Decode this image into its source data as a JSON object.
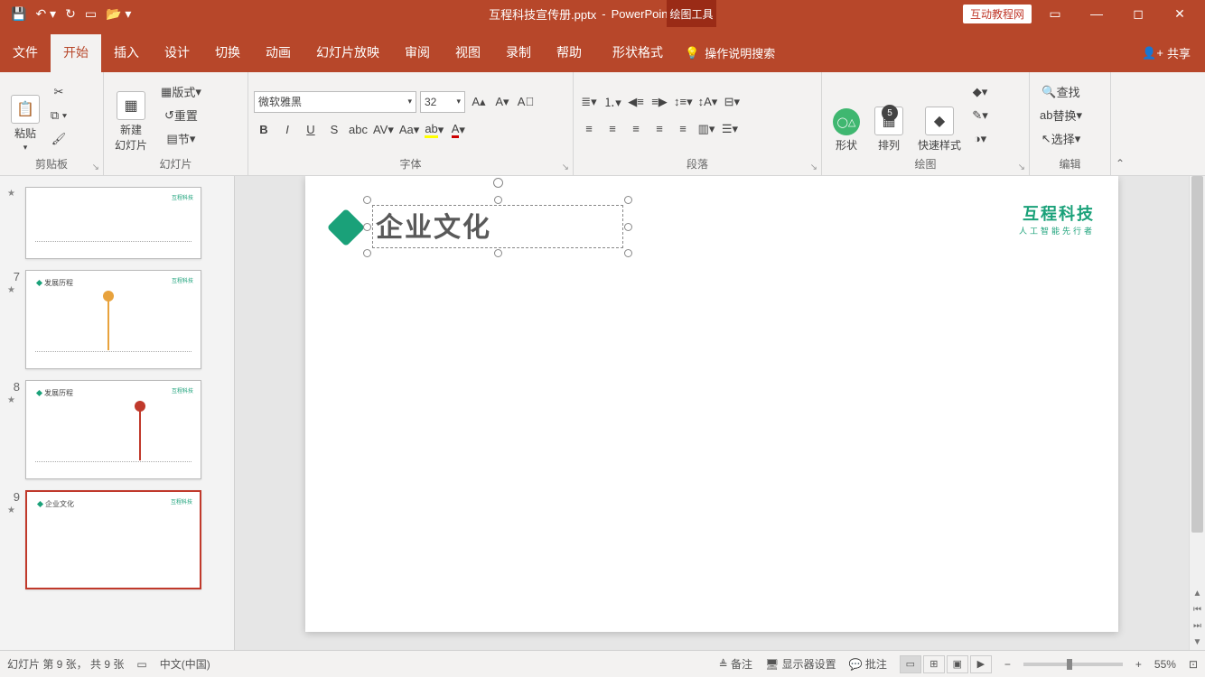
{
  "title": {
    "file": "互程科技宣传册.pptx",
    "app": "PowerPoint Preview",
    "context": "绘图工具",
    "badge": "互动教程网"
  },
  "tabs": {
    "file": "文件",
    "home": "开始",
    "insert": "插入",
    "design": "设计",
    "trans": "切换",
    "anim": "动画",
    "show": "幻灯片放映",
    "review": "审阅",
    "view": "视图",
    "record": "录制",
    "help": "帮助",
    "format": "形状格式",
    "search": "操作说明搜索",
    "share": "共享"
  },
  "ribbon": {
    "clipboard": {
      "paste": "粘贴",
      "label": "剪贴板"
    },
    "slides": {
      "new": "新建\n幻灯片",
      "layout": "版式",
      "reset": "重置",
      "section": "节",
      "label": "幻灯片"
    },
    "font": {
      "name": "微软雅黑",
      "size": "32",
      "label": "字体"
    },
    "para": {
      "label": "段落"
    },
    "draw": {
      "shape": "形状",
      "arrange": "排列",
      "quick": "快速样式",
      "label": "绘图",
      "badge": "5"
    },
    "edit": {
      "find": "查找",
      "replace": "替换",
      "select": "选择",
      "label": "编辑"
    }
  },
  "thumbs": [
    {
      "n": "",
      "title": ""
    },
    {
      "n": "7",
      "title": "发展历程"
    },
    {
      "n": "8",
      "title": "发展历程"
    },
    {
      "n": "9",
      "title": "企业文化"
    }
  ],
  "slide": {
    "title": "企业文化",
    "brand1": "互程科技",
    "brand2": "人工智能先行者"
  },
  "status": {
    "pos": "幻灯片 第 9 张， 共 9 张",
    "lang": "中文(中国)",
    "notes": "备注",
    "display": "显示器设置",
    "comment": "批注",
    "zoom": "55%"
  },
  "chart_data": null
}
